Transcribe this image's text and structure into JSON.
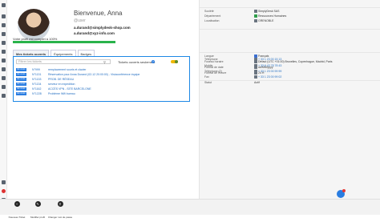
{
  "profile": {
    "welcome": "Bienvenue, Anna",
    "username": "@user",
    "email_primary": "a.durand@simplydesk-shop.com",
    "email_secondary": "a.durand@xyz-info.com",
    "completion_text": "Votre profil est complet à 100%",
    "completion_percent": 100
  },
  "tabs": [
    {
      "label": "Mes tickets ouverts"
    },
    {
      "label": "Équipements"
    },
    {
      "label": "Badges"
    }
  ],
  "ticket_panel": {
    "search_placeholder": "Filtrer les tickets",
    "open_only_label": "Tickets ouverts seulement",
    "toggle_on": true
  },
  "tickets": [
    {
      "badge": "En cours",
      "number": "N°999",
      "title": "remplacement souris et clavier"
    },
    {
      "badge": "En cours",
      "number": "N°1131",
      "title": "Réservation pour Anna Durand (02-12 20:00:00) - Visioconférence équipe"
    },
    {
      "badge": "En cours",
      "number": "N°1133",
      "title": "PROB. DE RÉSEAU"
    },
    {
      "badge": "En cours",
      "number": "N°1134",
      "title": "serveur en expedition"
    },
    {
      "badge": "En cours",
      "number": "N°1162",
      "title": "ACCÈS VPN - SITE BARCELONE"
    },
    {
      "badge": "En cours",
      "number": "N°1228",
      "title": "Problème Wifi bureau"
    }
  ],
  "details": {
    "org": [
      {
        "label": "Société",
        "value": "SimplyDesk SAS"
      },
      {
        "label": "Département",
        "value": "Ressources Humaines"
      },
      {
        "label": "Localisation",
        "value": "GRENOBLE"
      }
    ],
    "locale": [
      {
        "label": "Langue",
        "value": "Français"
      },
      {
        "label": "Fuseau horaire",
        "value": "Défaut (UTC +01:00) Bruxelles, Copenhague, Madrid, Paris"
      },
      {
        "label": "Format de date",
        "value": "dd/MM/yyyy"
      },
      {
        "label": "Format de l'heure",
        "value": "24 H"
      }
    ],
    "contact": [
      {
        "label": "Téléphone",
        "value": "+ 33 1 23 00 15 13"
      },
      {
        "label": "Mobile",
        "value": "+ 33 6 43 78 78 43"
      },
      {
        "label": "Téléphone (2)",
        "value": "+ 33 1 23 00 99 99"
      },
      {
        "label": "Fax",
        "value": "+ 33 1 23 00 99 02"
      },
      {
        "label": "Statut",
        "value": "Actif"
      }
    ]
  },
  "bottom_bar": [
    {
      "label": "Nouveau Ticket",
      "icon": "plus-icon"
    },
    {
      "label": "Modifier profil",
      "icon": "edit-icon"
    },
    {
      "label": "Changer mot de passe",
      "icon": "key-icon"
    }
  ],
  "colors": {
    "accent": "#1e88e5",
    "progress": "#29b34b",
    "toggle": "#f0b800"
  }
}
